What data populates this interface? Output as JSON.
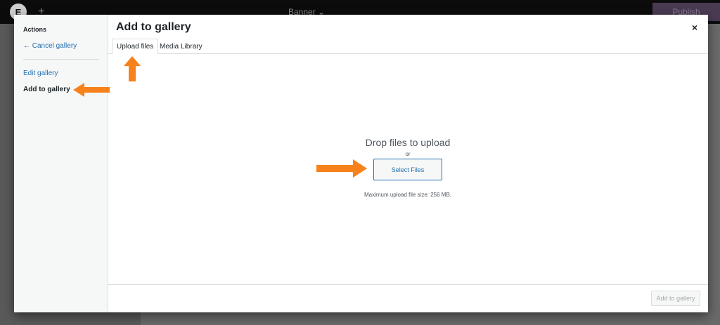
{
  "editor": {
    "logo": "E",
    "page_name": "Banner ⌄",
    "publish_label": "Publish"
  },
  "modal": {
    "title": "Add to gallery",
    "close_glyph": "×",
    "menu": {
      "heading": "Actions",
      "cancel_label": "← Cancel gallery",
      "edit_label": "Edit gallery",
      "add_label": "Add to gallery"
    },
    "tabs": [
      {
        "label": "Upload files",
        "active": true
      },
      {
        "label": "Media Library",
        "active": false
      }
    ],
    "upload": {
      "drop_text": "Drop files to upload",
      "or_text": "or",
      "select_button": "Select Files",
      "max_size": "Maximum upload file size: 256 MB."
    },
    "toolbar": {
      "add_button": "Add to gallery"
    }
  },
  "colors": {
    "accent": "#2271b1",
    "annotation_arrow": "#f7821b"
  }
}
